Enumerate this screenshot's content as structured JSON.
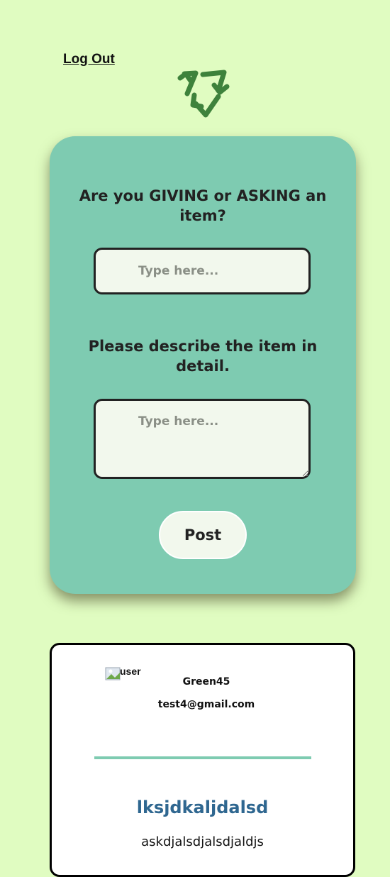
{
  "header": {
    "logout_label": "Log Out",
    "logo_icon": "recycle-icon",
    "logo_color": "#3e823c"
  },
  "form": {
    "question1": "Are you GIVING or ASKING an item?",
    "input1_placeholder": "Type here...",
    "question2": "Please describe the item in detail.",
    "input2_placeholder": "Type here...",
    "post_label": "Post"
  },
  "post": {
    "avatar_alt": "user",
    "username": "Green45",
    "email": "test4@gmail.com",
    "title": "lksjdkaljdalsd",
    "description": "askdjalsdjalsdjaldjs"
  },
  "colors": {
    "background": "#e0fcc1",
    "card": "#7ecbb1",
    "field": "#f2f8ed",
    "post_title": "#2f6790"
  }
}
